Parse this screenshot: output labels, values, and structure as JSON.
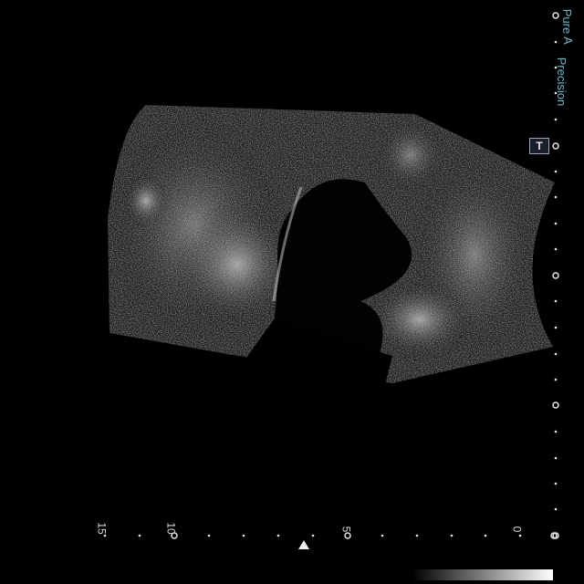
{
  "overlay": {
    "mode_pure": "A",
    "mode_pure_word": "Pure",
    "mode_precision": "Precision",
    "focus_marker": "T"
  },
  "depth_scale": {
    "labels": [
      "0",
      "5",
      "10",
      "15"
    ],
    "marker_depth_cm": 5
  },
  "colors": {
    "background": "#000000",
    "overlay_text": "#6fb6c8",
    "scale_text": "#d8d8d8"
  }
}
